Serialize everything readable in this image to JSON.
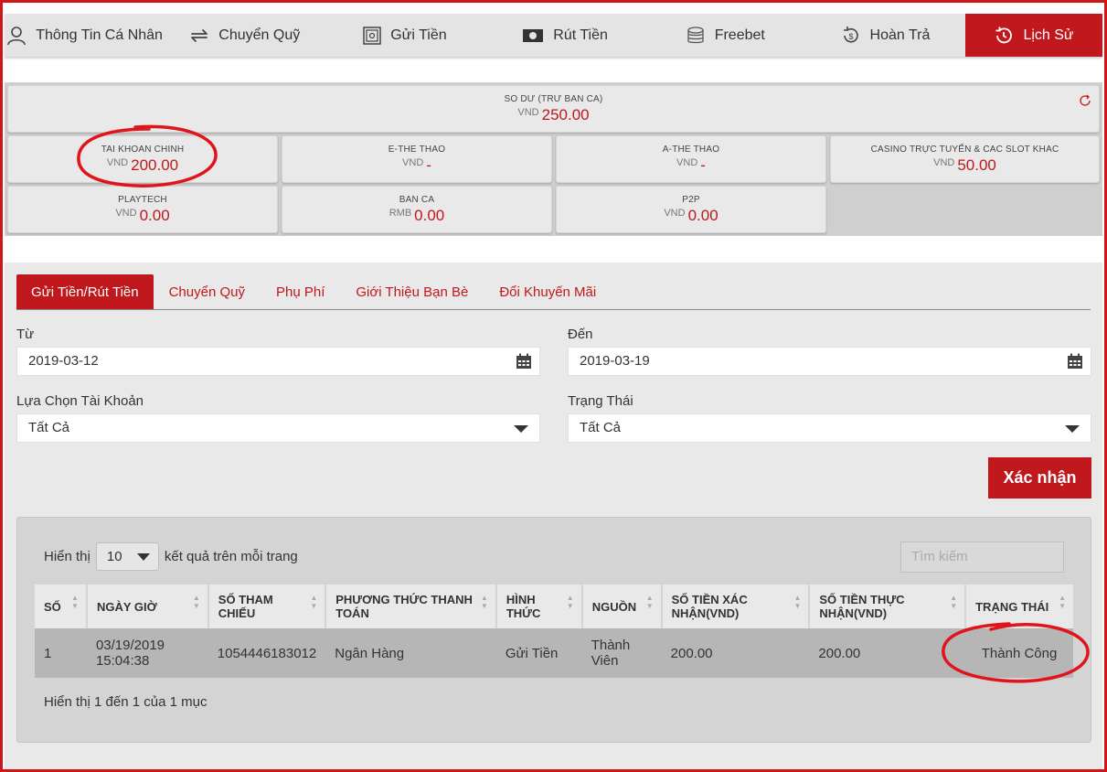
{
  "nav": {
    "items": [
      {
        "label": "Thông Tin Cá Nhân",
        "icon": "user-icon"
      },
      {
        "label": "Chuyển Quỹ",
        "icon": "transfer-icon"
      },
      {
        "label": "Gửi Tiền",
        "icon": "safe-icon"
      },
      {
        "label": "Rút Tiền",
        "icon": "cash-icon"
      },
      {
        "label": "Freebet",
        "icon": "coins-icon"
      },
      {
        "label": "Hoàn Trả",
        "icon": "refund-icon"
      },
      {
        "label": "Lịch Sử",
        "icon": "history-icon"
      }
    ],
    "active": "Lịch Sử"
  },
  "balance": {
    "total": {
      "label": "SO DƯ (TRƯ BAN CA)",
      "currency": "VND",
      "value": "250.00"
    },
    "wallets": [
      {
        "label": "TAI KHOAN CHINH",
        "currency": "VND",
        "value": "200.00"
      },
      {
        "label": "E-THE THAO",
        "currency": "VND",
        "value": "-"
      },
      {
        "label": "A-THE THAO",
        "currency": "VND",
        "value": "-"
      },
      {
        "label": "CASINO TRỰC TUYẾN & CAC SLOT KHAC",
        "currency": "VND",
        "value": "50.00"
      },
      {
        "label": "PLAYTECH",
        "currency": "VND",
        "value": "0.00"
      },
      {
        "label": "BAN CA",
        "currency": "RMB",
        "value": "0.00"
      },
      {
        "label": "P2P",
        "currency": "VND",
        "value": "0.00"
      }
    ]
  },
  "tabs": [
    "Gửi Tiền/Rút Tiền",
    "Chuyển Quỹ",
    "Phụ Phí",
    "Giới Thiệu Bạn Bè",
    "Đổi Khuyến Mãi"
  ],
  "filters": {
    "from_label": "Từ",
    "from_value": "2019-03-12",
    "to_label": "Đến",
    "to_value": "2019-03-19",
    "account_label": "Lựa Chọn Tài Khoản",
    "account_value": "Tất Cả",
    "status_label": "Trạng Thái",
    "status_value": "Tất Cả",
    "confirm_label": "Xác nhận"
  },
  "table": {
    "show_prefix": "Hiển thị",
    "page_size": "10",
    "show_suffix": "kết quả trên mỗi trang",
    "search_placeholder": "Tìm kiếm",
    "columns": [
      "SỐ",
      "NGÀY GIỜ",
      "SỐ THAM CHIẾU",
      "PHƯƠNG THỨC THANH TOÁN",
      "HÌNH THỨC",
      "NGUỒN",
      "SỐ TIỀN XÁC NHẬN(VND)",
      "SỐ TIỀN THỰC NHẬN(VND)",
      "TRẠNG THÁI"
    ],
    "rows": [
      [
        "1",
        "03/19/2019 15:04:38",
        "1054446183012",
        "Ngân Hàng",
        "Gửi Tiền",
        "Thành Viên",
        "200.00",
        "200.00",
        "Thành Công"
      ]
    ],
    "info": "Hiển thị 1 đến 1 của 1 mục"
  },
  "colors": {
    "accent": "#c0181d",
    "annotation": "#e0141a"
  }
}
